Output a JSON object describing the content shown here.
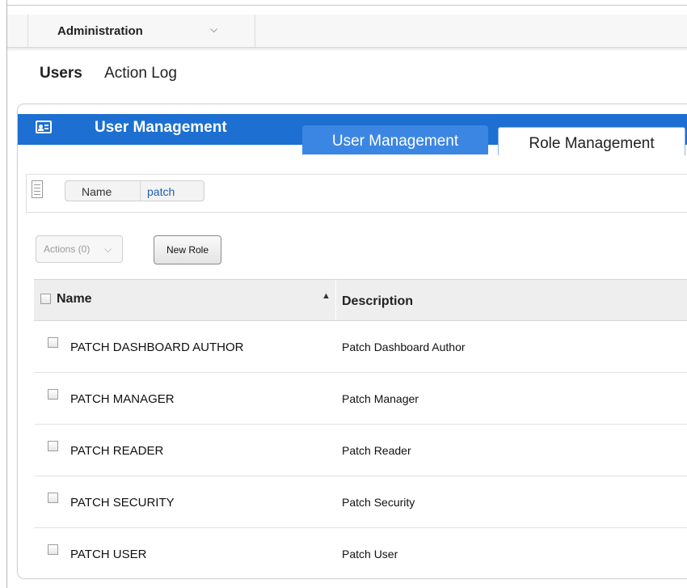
{
  "admin_menu": {
    "label": "Administration"
  },
  "subnav": {
    "items": [
      "Users",
      "Action Log"
    ],
    "active_index": 0
  },
  "panel": {
    "title": "User Management",
    "tabs": [
      {
        "label": "User Management",
        "active": true
      },
      {
        "label": "Role Management",
        "active": false
      }
    ]
  },
  "filter": {
    "field": "Name",
    "value": "patch"
  },
  "toolbar": {
    "actions_label": "Actions (0)",
    "new_role_label": "New Role"
  },
  "table": {
    "columns": [
      "Name",
      "Description"
    ],
    "rows": [
      {
        "name": "PATCH DASHBOARD AUTHOR",
        "description": "Patch Dashboard Author"
      },
      {
        "name": "PATCH MANAGER",
        "description": "Patch Manager"
      },
      {
        "name": "PATCH READER",
        "description": "Patch Reader"
      },
      {
        "name": "PATCH SECURITY",
        "description": "Patch Security"
      },
      {
        "name": "PATCH USER",
        "description": "Patch User"
      }
    ]
  },
  "colors": {
    "header_blue": "#1d6fd1",
    "active_tab": "#3c86e3",
    "link_blue": "#1a5fb4"
  }
}
